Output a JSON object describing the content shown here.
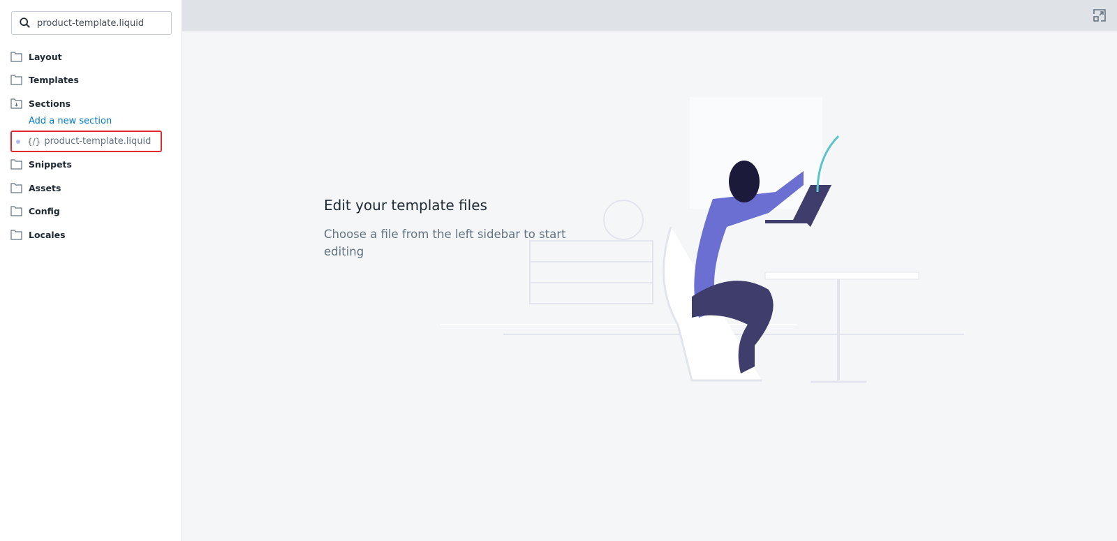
{
  "sidebar": {
    "search": {
      "value": "product-template.liquid",
      "icon": "search-icon"
    },
    "folders": [
      {
        "label": "Layout"
      },
      {
        "label": "Templates"
      },
      {
        "label": "Sections"
      },
      {
        "label": "Snippets"
      },
      {
        "label": "Assets"
      },
      {
        "label": "Config"
      },
      {
        "label": "Locales"
      }
    ],
    "add_section_link": "Add a new section",
    "selected_file": {
      "code_icon": "{/}",
      "name": "product-template.liquid"
    }
  },
  "topbar": {
    "expand_icon": "expand-icon"
  },
  "main": {
    "title": "Edit your template files",
    "subtitle": "Choose a file from the left sidebar to start editing"
  },
  "colors": {
    "highlight_border": "#e0282e",
    "link": "#007ace",
    "illustration_purple": "#6a6fd1"
  }
}
